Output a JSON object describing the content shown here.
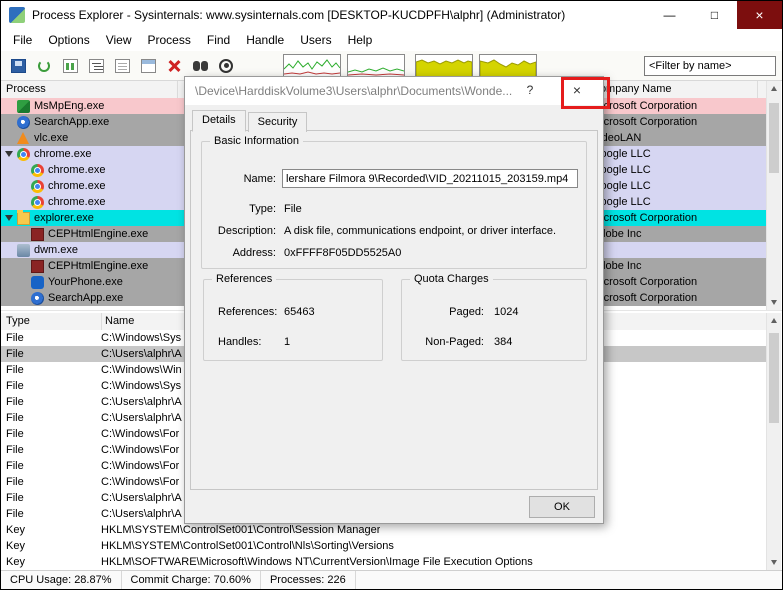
{
  "window": {
    "title": "Process Explorer - Sysinternals: www.sysinternals.com [DESKTOP-KUCDPFH\\alphr] (Administrator)",
    "controls": {
      "minimize": "—",
      "maximize": "□",
      "close": "×"
    }
  },
  "menu": {
    "items": [
      "File",
      "Options",
      "View",
      "Process",
      "Find",
      "Handle",
      "Users",
      "Help"
    ]
  },
  "toolbar": {
    "buttons": [
      {
        "id": "save",
        "icon": "floppy-icon"
      },
      {
        "id": "refresh",
        "icon": "refresh-icon"
      },
      {
        "id": "system-info",
        "icon": "chart-icon"
      },
      {
        "id": "process-tree",
        "icon": "tree-icon"
      },
      {
        "id": "dll-view",
        "icon": "page-icon"
      },
      {
        "id": "properties",
        "icon": "window-icon"
      },
      {
        "id": "kill-process",
        "icon": "red-x-icon"
      },
      {
        "id": "find-handle",
        "icon": "binoculars-icon"
      },
      {
        "id": "find-window",
        "icon": "target-icon"
      }
    ],
    "graphs": [
      "cpu-usage-graph",
      "cpu-history-graph",
      "commit-history-graph",
      "io-history-graph"
    ],
    "filter_value": "<Filter by name>"
  },
  "process_pane": {
    "columns": {
      "process": "Process",
      "company": "Company Name"
    },
    "rows": [
      {
        "name": "MsMpEng.exe",
        "company": "Microsoft Corporation",
        "color": "pink",
        "icon": "defender",
        "indent": 1
      },
      {
        "name": "SearchApp.exe",
        "company": "Microsoft Corporation",
        "color": "gray",
        "icon": "search",
        "indent": 1
      },
      {
        "name": "vlc.exe",
        "company": "VideoLAN",
        "color": "gray",
        "icon": "vlc",
        "indent": 1
      },
      {
        "name": "chrome.exe",
        "company": "Google LLC",
        "color": "lavender",
        "icon": "chrome",
        "indent": 1,
        "expander": true
      },
      {
        "name": "chrome.exe",
        "company": "Google LLC",
        "color": "lavender",
        "icon": "chrome",
        "indent": 2
      },
      {
        "name": "chrome.exe",
        "company": "Google LLC",
        "color": "lavender",
        "icon": "chrome",
        "indent": 2
      },
      {
        "name": "chrome.exe",
        "company": "Google LLC",
        "color": "lavender",
        "icon": "chrome",
        "indent": 2
      },
      {
        "name": "explorer.exe",
        "company": "Microsoft Corporation",
        "color": "cyan",
        "icon": "explorer",
        "indent": 1,
        "expander": true
      },
      {
        "name": "CEPHtmlEngine.exe",
        "company": "Adobe Inc",
        "color": "gray",
        "icon": "cep",
        "indent": 2
      },
      {
        "name": "dwm.exe",
        "company": "",
        "color": "lavender",
        "icon": "dwm",
        "indent": 1
      },
      {
        "name": "CEPHtmlEngine.exe",
        "company": "Adobe Inc",
        "color": "gray",
        "icon": "cep",
        "indent": 2
      },
      {
        "name": "YourPhone.exe",
        "company": "Microsoft Corporation",
        "color": "gray",
        "icon": "phone",
        "indent": 2
      },
      {
        "name": "SearchApp.exe",
        "company": "Microsoft Corporation",
        "color": "gray",
        "icon": "search",
        "indent": 2
      }
    ]
  },
  "handle_pane": {
    "columns": {
      "type": "Type",
      "name": "Name"
    },
    "rows": [
      {
        "type": "File",
        "name": "C:\\Windows\\Sys"
      },
      {
        "type": "File",
        "name": "C:\\Users\\alphr\\A",
        "selected": true
      },
      {
        "type": "File",
        "name": "C:\\Windows\\Win"
      },
      {
        "type": "File",
        "name": "C:\\Windows\\Sys"
      },
      {
        "type": "File",
        "name": "C:\\Users\\alphr\\A"
      },
      {
        "type": "File",
        "name": "C:\\Users\\alphr\\A"
      },
      {
        "type": "File",
        "name": "C:\\Windows\\For"
      },
      {
        "type": "File",
        "name": "C:\\Windows\\For"
      },
      {
        "type": "File",
        "name": "C:\\Windows\\For"
      },
      {
        "type": "File",
        "name": "C:\\Windows\\For"
      },
      {
        "type": "File",
        "name": "C:\\Users\\alphr\\A"
      },
      {
        "type": "File",
        "name": "C:\\Users\\alphr\\A"
      },
      {
        "type": "Key",
        "name": "HKLM\\SYSTEM\\ControlSet001\\Control\\Session Manager"
      },
      {
        "type": "Key",
        "name": "HKLM\\SYSTEM\\ControlSet001\\Control\\Nls\\Sorting\\Versions"
      },
      {
        "type": "Key",
        "name": "HKLM\\SOFTWARE\\Microsoft\\Windows NT\\CurrentVersion\\Image File Execution Options"
      }
    ]
  },
  "status_bar": {
    "cpu": "CPU Usage: 28.87%",
    "commit": "Commit Charge: 70.60%",
    "processes": "Processes: 226"
  },
  "dialog": {
    "title": "\\Device\\HarddiskVolume3\\Users\\alphr\\Documents\\Wonde...",
    "help": "?",
    "close": "×",
    "tabs": [
      "Details",
      "Security"
    ],
    "basic": {
      "label": "Basic Information",
      "name_label": "Name:",
      "name_value": "lershare Filmora 9\\Recorded\\VID_20211015_203159.mp4",
      "type_label": "Type:",
      "type_value": "File",
      "desc_label": "Description:",
      "desc_value": "A disk file, communications endpoint, or driver interface.",
      "addr_label": "Address:",
      "addr_value": "0xFFFF8F05DD5525A0"
    },
    "references": {
      "label": "References",
      "ref_label": "References:",
      "ref_value": "65463",
      "handles_label": "Handles:",
      "handles_value": "1"
    },
    "quota": {
      "label": "Quota Charges",
      "paged_label": "Paged:",
      "paged_value": "1024",
      "nonpaged_label": "Non-Paged:",
      "nonpaged_value": "384"
    },
    "ok": "OK"
  }
}
